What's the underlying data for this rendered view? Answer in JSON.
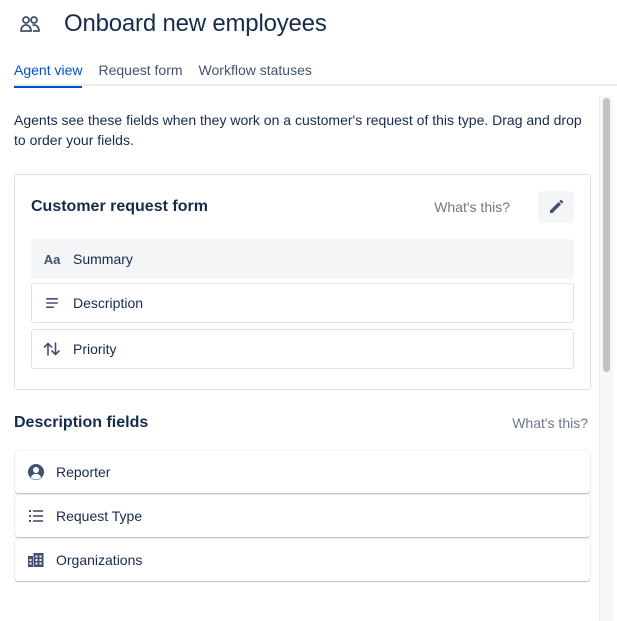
{
  "page": {
    "title": "Onboard new employees",
    "title_icon": "people-icon"
  },
  "tabs": [
    {
      "label": "Agent view",
      "active": true
    },
    {
      "label": "Request form",
      "active": false
    },
    {
      "label": "Workflow statuses",
      "active": false
    }
  ],
  "intro": "Agents see these fields when they work on a customer's request of this type. Drag and drop to order your fields.",
  "customer_request_form": {
    "title": "Customer request form",
    "whats_this": "What's this?",
    "edit_icon": "pencil-icon",
    "fields": [
      {
        "label": "Summary",
        "icon": "text-aa-icon",
        "icon_text": "Aa"
      },
      {
        "label": "Description",
        "icon": "lines-icon"
      },
      {
        "label": "Priority",
        "icon": "sort-arrows-icon"
      }
    ]
  },
  "description_fields": {
    "title": "Description fields",
    "whats_this": "What's this?",
    "fields": [
      {
        "label": "Reporter",
        "icon": "person-circle-icon"
      },
      {
        "label": "Request Type",
        "icon": "bullet-list-icon"
      },
      {
        "label": "Organizations",
        "icon": "building-icon"
      }
    ]
  },
  "colors": {
    "accent": "#0052cc",
    "text": "#172b4d",
    "subtle": "#6b778c",
    "border": "#dfe1e6"
  }
}
